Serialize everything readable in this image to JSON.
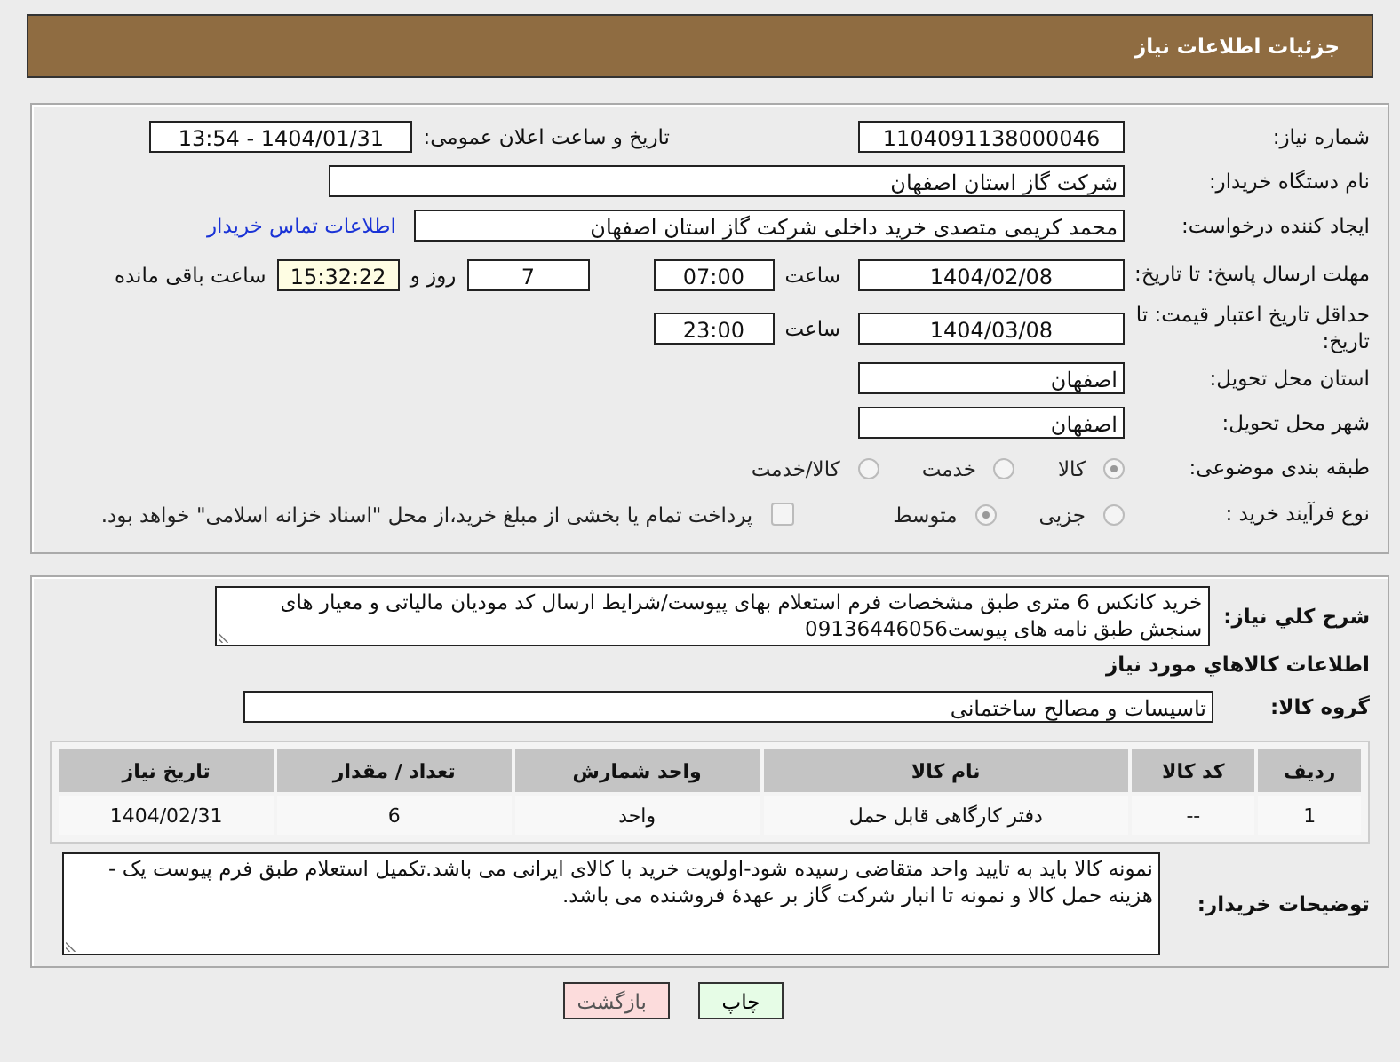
{
  "header": {
    "title": "جزئیات اطلاعات نیاز"
  },
  "need_number": {
    "label": "شماره نیاز:",
    "value": "1104091138000046"
  },
  "announce": {
    "label": "تاریخ و ساعت اعلان عمومی:",
    "value": "1404/01/31 - 13:54"
  },
  "buyer_org": {
    "label": "نام دستگاه خریدار:",
    "value": "شرکت گاز استان اصفهان"
  },
  "creator": {
    "label": "ایجاد کننده درخواست:",
    "value": "محمد کریمی متصدی خرید داخلی شرکت گاز استان اصفهان",
    "link": "اطلاعات تماس خریدار"
  },
  "reply_deadline": {
    "label": "مهلت ارسال پاسخ: تا تاریخ:",
    "date": "1404/02/08",
    "time_label": "ساعت",
    "time": "07:00",
    "days": "7",
    "days_label": "روز و",
    "remaining": "15:32:22",
    "remaining_label": "ساعت باقی مانده"
  },
  "price_validity": {
    "label": "حداقل تاریخ اعتبار قیمت: تا تاریخ:",
    "date": "1404/03/08",
    "time_label": "ساعت",
    "time": "23:00"
  },
  "province": {
    "label": "استان محل تحویل:",
    "value": "اصفهان"
  },
  "city": {
    "label": "شهر محل تحویل:",
    "value": "اصفهان"
  },
  "category": {
    "label": "طبقه بندی موضوعی:",
    "options": [
      {
        "label": "کالا",
        "selected": true
      },
      {
        "label": "خدمت",
        "selected": false
      },
      {
        "label": "کالا/خدمت",
        "selected": false
      }
    ]
  },
  "process": {
    "label": "نوع فرآیند خرید :",
    "options": [
      {
        "label": "جزیی",
        "selected": false
      },
      {
        "label": "متوسط",
        "selected": true
      }
    ],
    "payment": {
      "checked": false,
      "label": "پرداخت تمام یا بخشی از مبلغ خرید،از محل \"اسناد خزانه اسلامی\" خواهد بود."
    }
  },
  "description": {
    "label": "شرح کلي نياز:",
    "value": "خرید کانکس 6 متری طبق مشخصات فرم استعلام بهای پیوست/شرایط  ارسال کد مودیان مالیاتی و معیار های سنجش طبق نامه های پیوست09136446056"
  },
  "goods_heading": "اطلاعات کالاهاي مورد نياز",
  "goods_group": {
    "label": "گروه کالا:",
    "value": "تاسیسات و مصالح ساختمانی"
  },
  "table": {
    "columns": [
      "ردیف",
      "کد کالا",
      "نام کالا",
      "واحد شمارش",
      "تعداد / مقدار",
      "تاریخ نیاز"
    ],
    "rows": [
      [
        "1",
        "--",
        "دفتر کارگاهی قابل حمل",
        "واحد",
        "6",
        "1404/02/31"
      ]
    ]
  },
  "buyer_notes": {
    "label": "توضیحات خریدار:",
    "value": "نمونه کالا باید به تایید واحد متقاضی رسیده شود-اولویت خرید با کالای ایرانی می باشد.تکمیل استعلام طبق فرم پیوست یک - هزینه حمل کالا و نمونه تا انبار شرکت گاز بر عهدهٔ فروشنده می باشد."
  },
  "buttons": [
    {
      "kind": "print",
      "label": "چاپ"
    },
    {
      "kind": "back",
      "label": "بازگشت"
    }
  ]
}
